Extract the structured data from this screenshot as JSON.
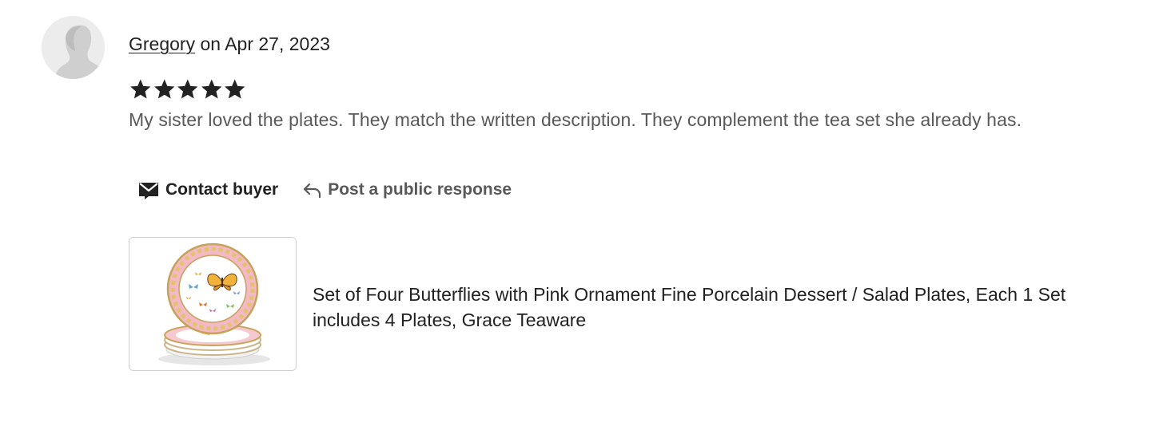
{
  "review": {
    "reviewer_name": "Gregory",
    "date_text": " on Apr 27, 2023",
    "rating": 5,
    "rating_max": 5,
    "text": "My sister loved the plates. They match the written description. They complement the tea set she already has."
  },
  "actions": {
    "contact_label": "Contact buyer",
    "respond_label": "Post a public response"
  },
  "product": {
    "title": "Set of Four Butterflies with Pink Ornament Fine Porcelain Dessert / Salad Plates, Each 1 Set includes 4 Plates, Grace Teaware"
  },
  "icons": {
    "avatar": "default-user-avatar-icon",
    "stars": "star-icon",
    "contact": "envelope-icon",
    "respond": "reply-arrow-icon"
  },
  "colors": {
    "text_primary": "#222222",
    "text_secondary": "#595959",
    "star": "#222222",
    "thumb_border": "#d0d0d0"
  }
}
